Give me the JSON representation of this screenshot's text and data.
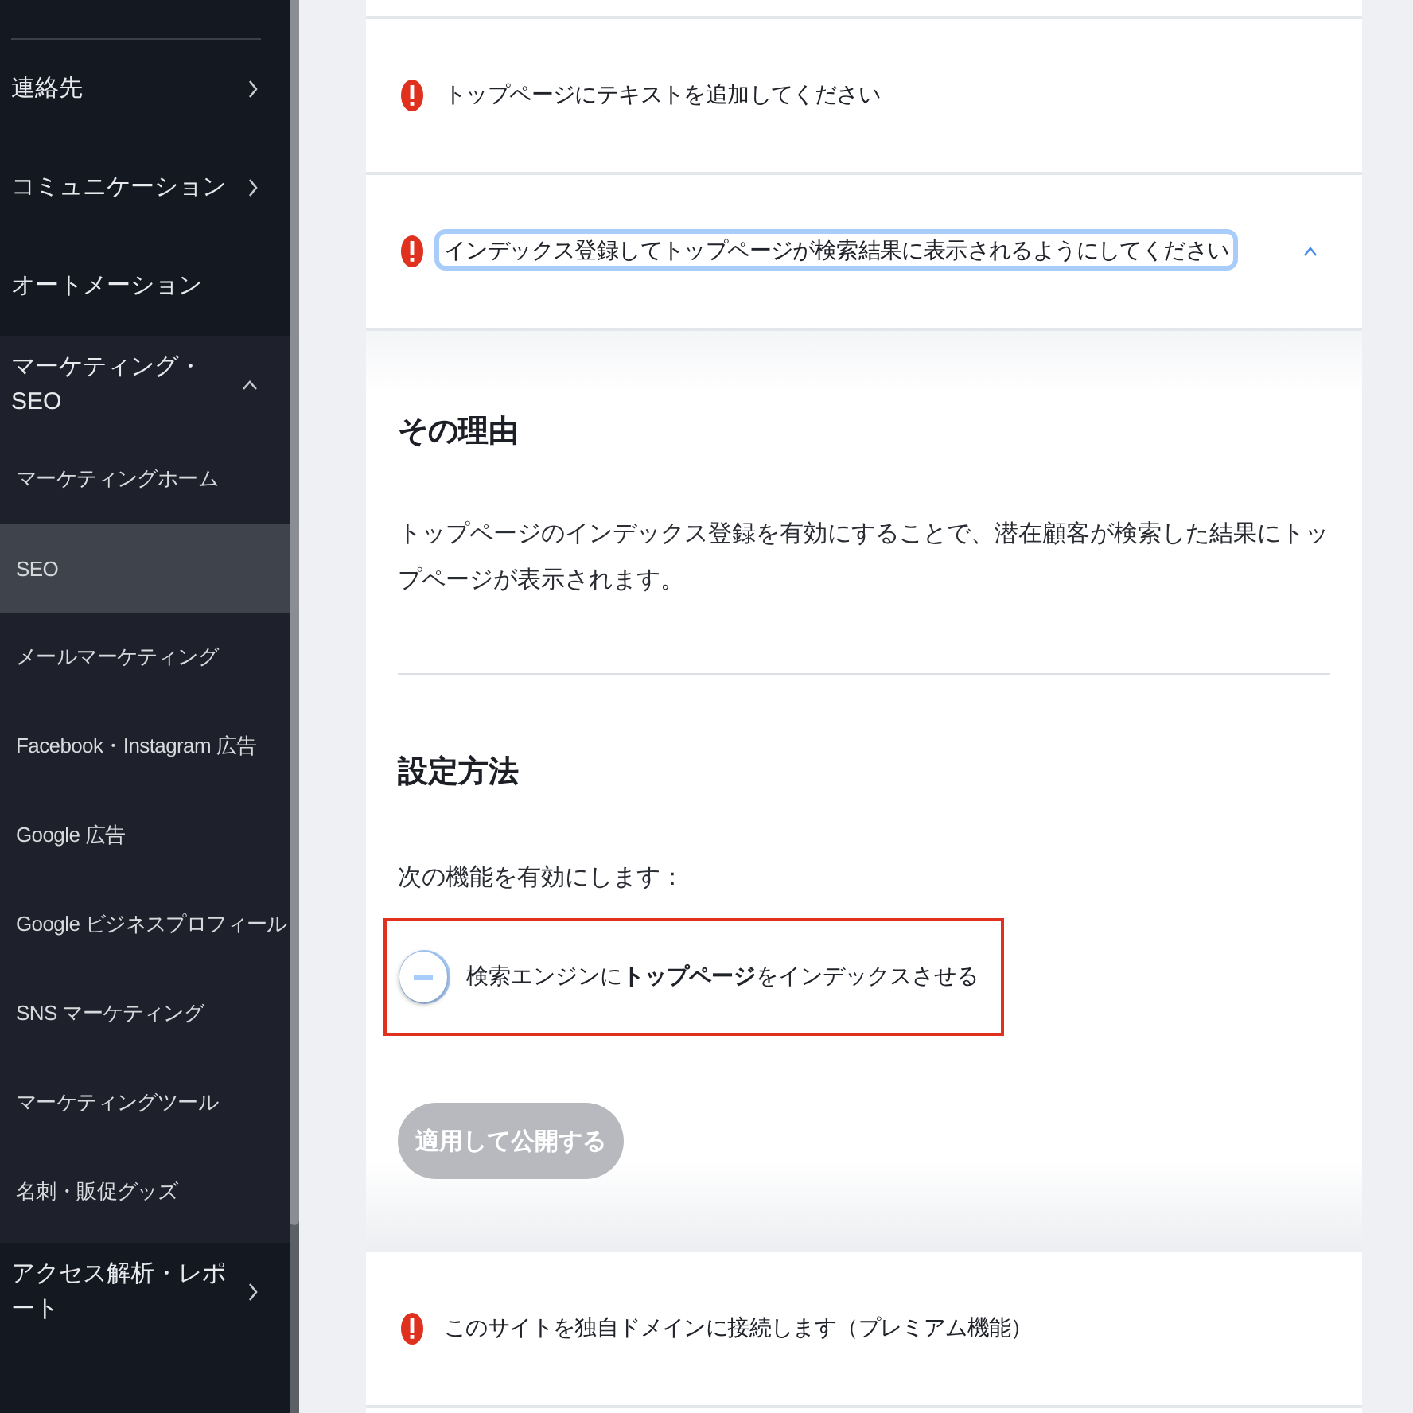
{
  "sidebar": {
    "items": [
      {
        "label": "連絡先",
        "kind": "group",
        "expanded": false
      },
      {
        "label": "コミュニケーション",
        "kind": "group",
        "expanded": false
      },
      {
        "label": "オートメーション",
        "kind": "link"
      },
      {
        "label": "マーケティング・SEO",
        "kind": "group",
        "expanded": true,
        "children": [
          {
            "label": "マーケティングホーム",
            "selected": false
          },
          {
            "label": "SEO",
            "selected": true
          },
          {
            "label": "メールマーケティング",
            "selected": false
          },
          {
            "label": "Facebook・Instagram 広告",
            "selected": false
          },
          {
            "label": "Google 広告",
            "selected": false
          },
          {
            "label": "Google ビジネスプロフィール",
            "selected": false
          },
          {
            "label": "SNS マーケティング",
            "selected": false
          },
          {
            "label": "マーケティングツール",
            "selected": false
          },
          {
            "label": "名刺・販促グッズ",
            "selected": false
          }
        ]
      },
      {
        "label": "アクセス解析・レポート",
        "kind": "group",
        "expanded": false
      }
    ]
  },
  "issues": [
    {
      "title": "トップページにテキストを追加してください",
      "expanded": false,
      "focused": false
    },
    {
      "title": "インデックス登録してトップページが検索結果に表示されるようにしてください",
      "expanded": true,
      "focused": true,
      "details": {
        "reason_heading": "その理由",
        "reason_text": "トップページのインデックス登録を有効にすることで、潜在顧客が検索した結果にトップページが表示されます。",
        "setup_heading": "設定方法",
        "setup_intro": "次の機能を有効にします：",
        "toggle": {
          "label": "検索エンジンに**トップページ**をインデックスさせる",
          "on": false,
          "highlighted": true
        },
        "apply_button": {
          "label": "適用して公開する",
          "disabled": true
        }
      }
    },
    {
      "title": "このサイトを独自ドメインに接続します（プレミアム機能）",
      "expanded": false,
      "focused": false
    }
  ]
}
